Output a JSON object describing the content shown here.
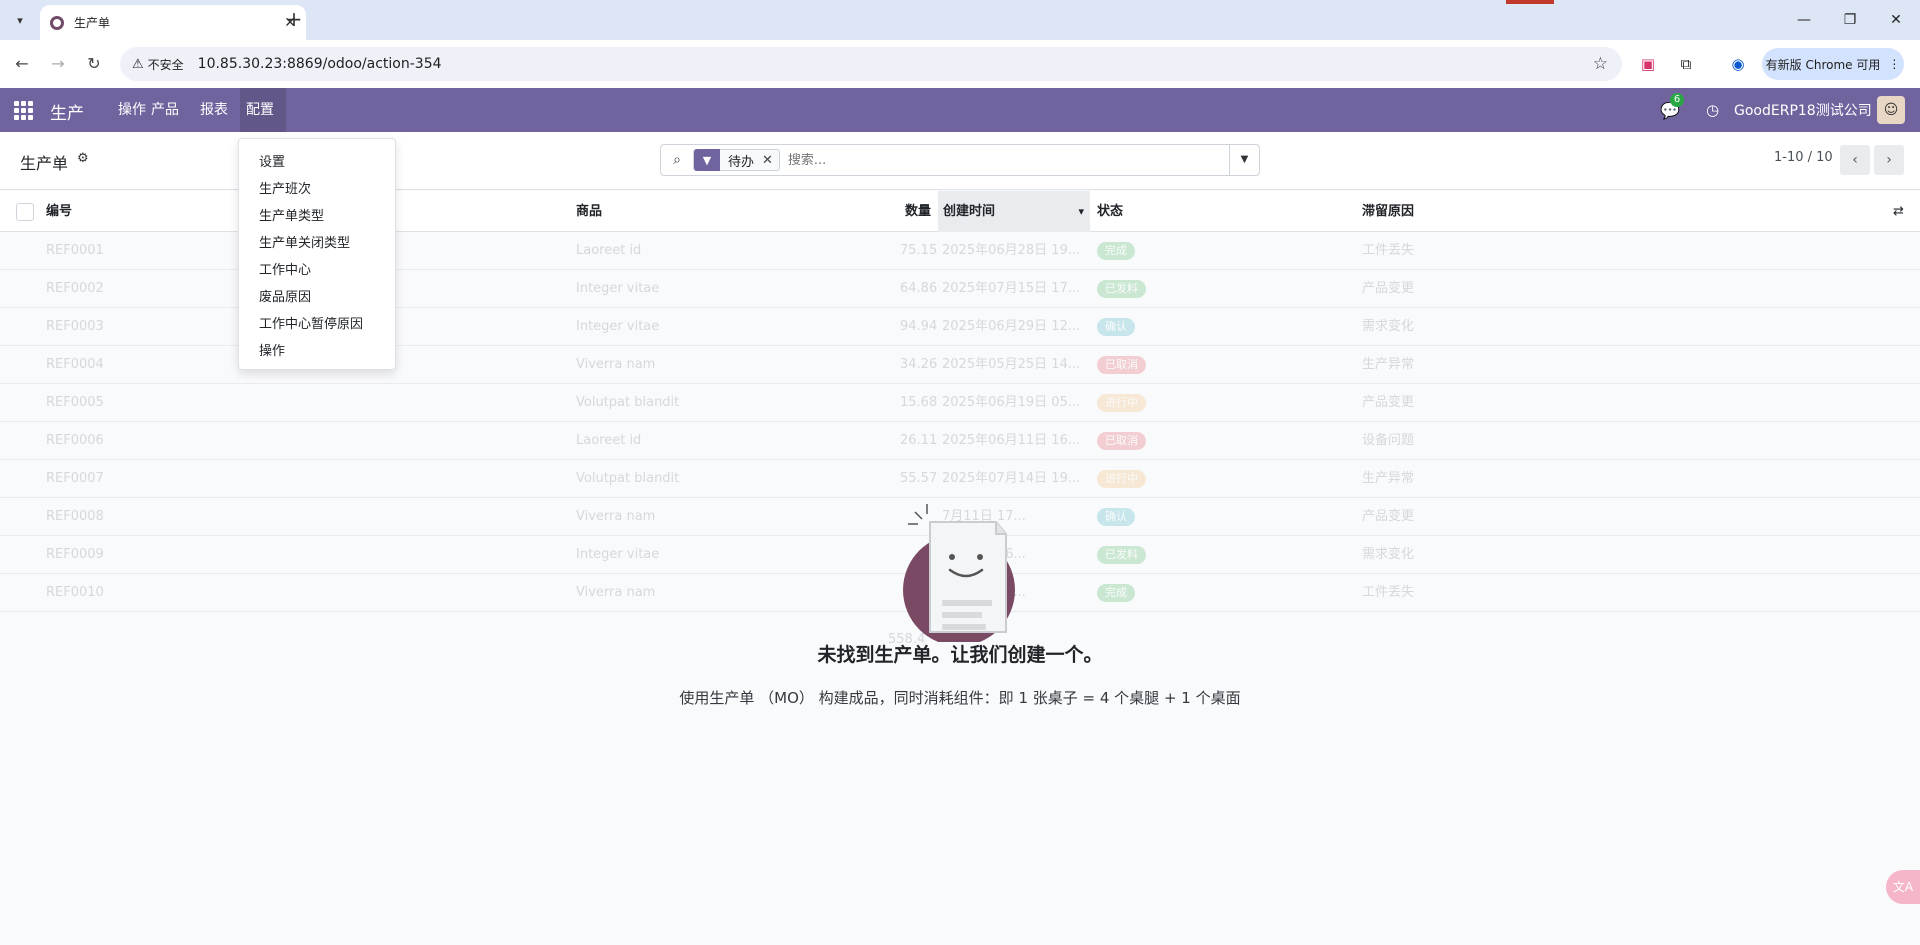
{
  "browser": {
    "tab_title": "生产单",
    "tab_close": "✕",
    "new_tab": "+",
    "insecure_label": "不安全",
    "url": "10.85.30.23:8869/odoo/action-354",
    "update_label": "有新版 Chrome 可用"
  },
  "navbar": {
    "app_name": "生产",
    "menu": [
      "操作",
      "产品",
      "报表",
      "配置"
    ],
    "chat_badge": "6",
    "company": "GoodERP18测试公司"
  },
  "control": {
    "title": "生产单",
    "facet_label": "待办",
    "search_placeholder": "搜索...",
    "pager": "1-10 / 10"
  },
  "columns": {
    "ref": "编号",
    "product": "商品",
    "qty": "数量",
    "created": "创建时间",
    "state": "状态",
    "reason": "滞留原因"
  },
  "rows": [
    {
      "ref": "REF0001",
      "product": "Laoreet id",
      "qty": "75.15",
      "date": "2025年06月28日 19...",
      "state": "完成",
      "state_color": "#28a745",
      "reason": "工件丢失"
    },
    {
      "ref": "REF0002",
      "product": "Integer vitae",
      "qty": "64.86",
      "date": "2025年07月15日 17...",
      "state": "已发料",
      "state_color": "#28a745",
      "reason": "产品变更"
    },
    {
      "ref": "REF0003",
      "product": "Integer vitae",
      "qty": "94.94",
      "date": "2025年06月29日 12...",
      "state": "确认",
      "state_color": "#17a2b8",
      "reason": "需求变化"
    },
    {
      "ref": "REF0004",
      "product": "Viverra nam",
      "qty": "34.26",
      "date": "2025年05月25日 14...",
      "state": "已取消",
      "state_color": "#dc3545",
      "reason": "生产异常"
    },
    {
      "ref": "REF0005",
      "product": "Volutpat blandit",
      "qty": "15.68",
      "date": "2025年06月19日 05...",
      "state": "进行中",
      "state_color": "#f0ad4e",
      "reason": "产品变更"
    },
    {
      "ref": "REF0006",
      "product": "Laoreet id",
      "qty": "26.11",
      "date": "2025年06月11日 16...",
      "state": "已取消",
      "state_color": "#dc3545",
      "reason": "设备问题"
    },
    {
      "ref": "REF0007",
      "product": "Volutpat blandit",
      "qty": "55.57",
      "date": "2025年07月14日 19...",
      "state": "进行中",
      "state_color": "#f0ad4e",
      "reason": "生产异常"
    },
    {
      "ref": "REF0008",
      "product": "Viverra nam",
      "qty": "",
      "date": "7月11日 17...",
      "state": "确认",
      "state_color": "#17a2b8",
      "reason": "产品变更"
    },
    {
      "ref": "REF0009",
      "product": "Integer vitae",
      "qty": "",
      "date": "7月12日 16...",
      "state": "已发料",
      "state_color": "#28a745",
      "reason": "需求变化"
    },
    {
      "ref": "REF0010",
      "product": "Viverra nam",
      "qty": "",
      "date": "7月21日 20...",
      "state": "完成",
      "state_color": "#28a745",
      "reason": "工件丢失"
    }
  ],
  "total_qty": "558.4",
  "dropdown": [
    "设置",
    "生产班次",
    "生产单类型",
    "生产单关闭类型",
    "工作中心",
    "废品原因",
    "工作中心暂停原因",
    "操作"
  ],
  "helper": {
    "title": "未找到生产单。让我们创建一个。",
    "text": "使用生产单 （MO） 构建成品，同时消耗组件：即 1 张桌子 = 4 个桌腿 + 1 个桌面"
  }
}
